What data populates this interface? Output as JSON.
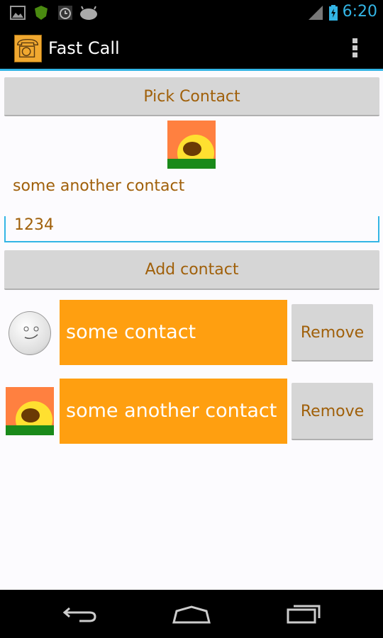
{
  "status_bar": {
    "time": "6:20",
    "icons": [
      "picture-icon",
      "shield-icon",
      "alarm-icon",
      "android-icon",
      "signal-icon",
      "battery-charging-icon"
    ]
  },
  "action_bar": {
    "title": "Fast Call",
    "app_icon": "telephone-icon",
    "menu_icon": "overflow-menu-icon"
  },
  "form": {
    "pick_contact_label": "Pick Contact",
    "contact_name": "some another contact",
    "phone_value": "1234",
    "add_contact_label": "Add contact"
  },
  "contacts": [
    {
      "name": "some contact",
      "avatar": "smiley-face-avatar",
      "remove_label": "Remove"
    },
    {
      "name": "some another contact",
      "avatar": "sunrise-avatar",
      "remove_label": "Remove"
    }
  ],
  "nav_bar": {
    "icons": [
      "back-icon",
      "home-icon",
      "recents-icon"
    ]
  },
  "colors": {
    "accent": "#33b5e5",
    "text": "#a0600a",
    "card": "#ff9f10"
  }
}
